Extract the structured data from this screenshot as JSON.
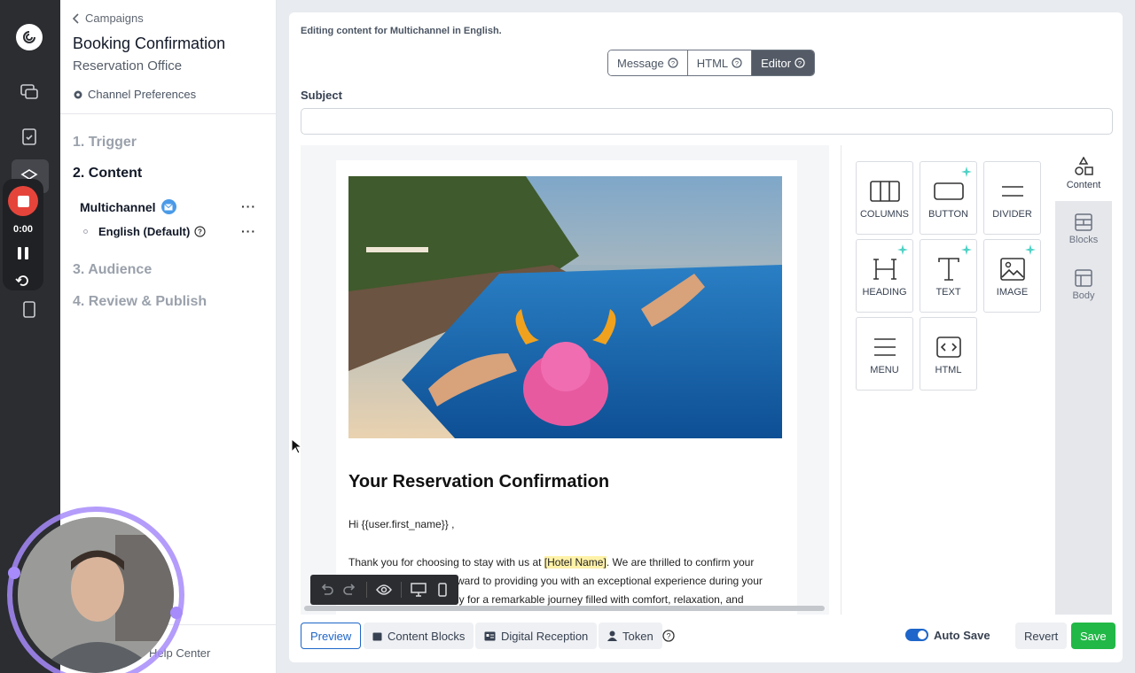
{
  "recorder": {
    "time": "0:00"
  },
  "sidebar": {
    "back_label": "Campaigns",
    "title": "Booking Confirmation",
    "subtitle": "Reservation Office",
    "channel_prefs": "Channel Preferences",
    "steps": [
      "1. Trigger",
      "2. Content",
      "3. Audience",
      "4. Review & Publish"
    ],
    "active_step": "2. Content",
    "channel": "Multichannel",
    "language": "English (Default)",
    "more": "···",
    "help": "Help Center"
  },
  "editor": {
    "note": "Editing content for Multichannel in English.",
    "modes": [
      "Message",
      "HTML",
      "Editor"
    ],
    "selected_mode": "Editor",
    "subject_label": "Subject",
    "subject_value": ""
  },
  "email": {
    "heading": "Your Reservation Confirmation",
    "greeting": "Hi {{user.first_name}} ,",
    "para_pre": "Thank you for choosing to stay with us at ",
    "placeholder": "[Hotel Name]",
    "para_post": ". We are thrilled to confirm your",
    "line2_tail": "rward to providing you with an exceptional experience during your",
    "line3_tail": "dy for a remarkable journey filled with comfort, relaxation, and"
  },
  "tools": [
    {
      "label": "COLUMNS",
      "icon": "columns-icon"
    },
    {
      "label": "BUTTON",
      "icon": "button-icon"
    },
    {
      "label": "DIVIDER",
      "icon": "divider-icon"
    },
    {
      "label": "HEADING",
      "icon": "heading-icon"
    },
    {
      "label": "TEXT",
      "icon": "text-icon"
    },
    {
      "label": "IMAGE",
      "icon": "image-icon"
    },
    {
      "label": "MENU",
      "icon": "menu-icon"
    },
    {
      "label": "HTML",
      "icon": "html-icon"
    }
  ],
  "tabs": [
    "Content",
    "Blocks",
    "Body"
  ],
  "bottom": {
    "preview": "Preview",
    "content_blocks": "Content Blocks",
    "digital_reception": "Digital Reception",
    "token": "Token",
    "auto_save": "Auto Save",
    "revert": "Revert",
    "save": "Save"
  },
  "colors": {
    "save": "#22b847",
    "accent": "#1e66c9",
    "record": "#e5443b"
  }
}
